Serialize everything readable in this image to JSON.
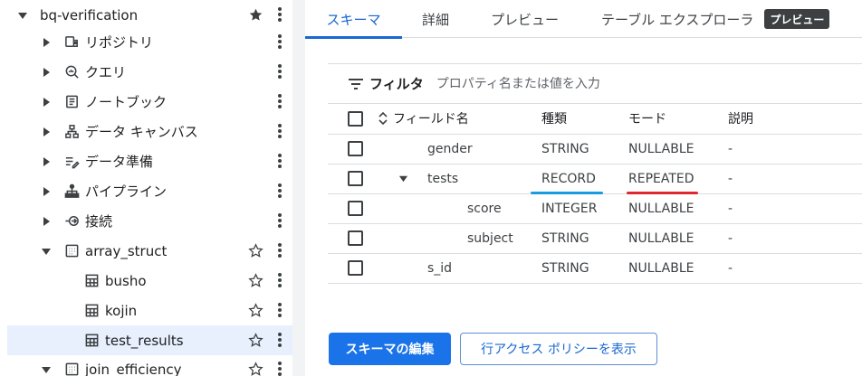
{
  "explorer": {
    "project": {
      "label": "bq-verification",
      "starred": true
    },
    "items": [
      {
        "label": "リポジトリ",
        "icon": "repository-icon"
      },
      {
        "label": "クエリ",
        "icon": "query-icon"
      },
      {
        "label": "ノートブック",
        "icon": "notebook-icon"
      },
      {
        "label": "データ キャンバス",
        "icon": "data-canvas-icon"
      },
      {
        "label": "データ準備",
        "icon": "data-preparation-icon"
      },
      {
        "label": "パイプライン",
        "icon": "pipeline-icon"
      },
      {
        "label": "接続",
        "icon": "connection-icon"
      }
    ],
    "dataset": {
      "label": "array_struct",
      "starred": false
    },
    "tables": [
      {
        "label": "busho",
        "starred": false
      },
      {
        "label": "kojin",
        "starred": false
      },
      {
        "label": "test_results",
        "starred": false,
        "selected": true
      }
    ],
    "next_dataset": {
      "label": "join_efficiency",
      "starred": false
    }
  },
  "tabs": [
    {
      "label": "スキーマ",
      "active": true
    },
    {
      "label": "詳細",
      "active": false
    },
    {
      "label": "プレビュー",
      "active": false
    },
    {
      "label": "テーブル エクスプローラ",
      "active": false,
      "badge": "プレビュー"
    }
  ],
  "filter": {
    "label": "フィルタ",
    "placeholder": "プロパティ名または値を入力"
  },
  "schema": {
    "headers": {
      "name": "フィールド名",
      "type": "種類",
      "mode": "モード",
      "description": "説明"
    },
    "rows": [
      {
        "name": "gender",
        "type": "STRING",
        "mode": "NULLABLE",
        "description": "-",
        "level": 0,
        "expandable": false
      },
      {
        "name": "tests",
        "type": "RECORD",
        "mode": "REPEATED",
        "description": "-",
        "level": 0,
        "expandable": true
      },
      {
        "name": "score",
        "type": "INTEGER",
        "mode": "NULLABLE",
        "description": "-",
        "level": 1,
        "expandable": false
      },
      {
        "name": "subject",
        "type": "STRING",
        "mode": "NULLABLE",
        "description": "-",
        "level": 1,
        "expandable": false
      },
      {
        "name": "s_id",
        "type": "STRING",
        "mode": "NULLABLE",
        "description": "-",
        "level": 0,
        "expandable": false
      }
    ]
  },
  "buttons": {
    "edit_schema": "スキーマの編集",
    "row_access_policy": "行アクセス ポリシーを表示"
  },
  "colors": {
    "accent": "#1a73e8",
    "highlight_blue": "#1a9be0",
    "highlight_red": "#e0262e",
    "selected_row": "#e8f0fe"
  }
}
